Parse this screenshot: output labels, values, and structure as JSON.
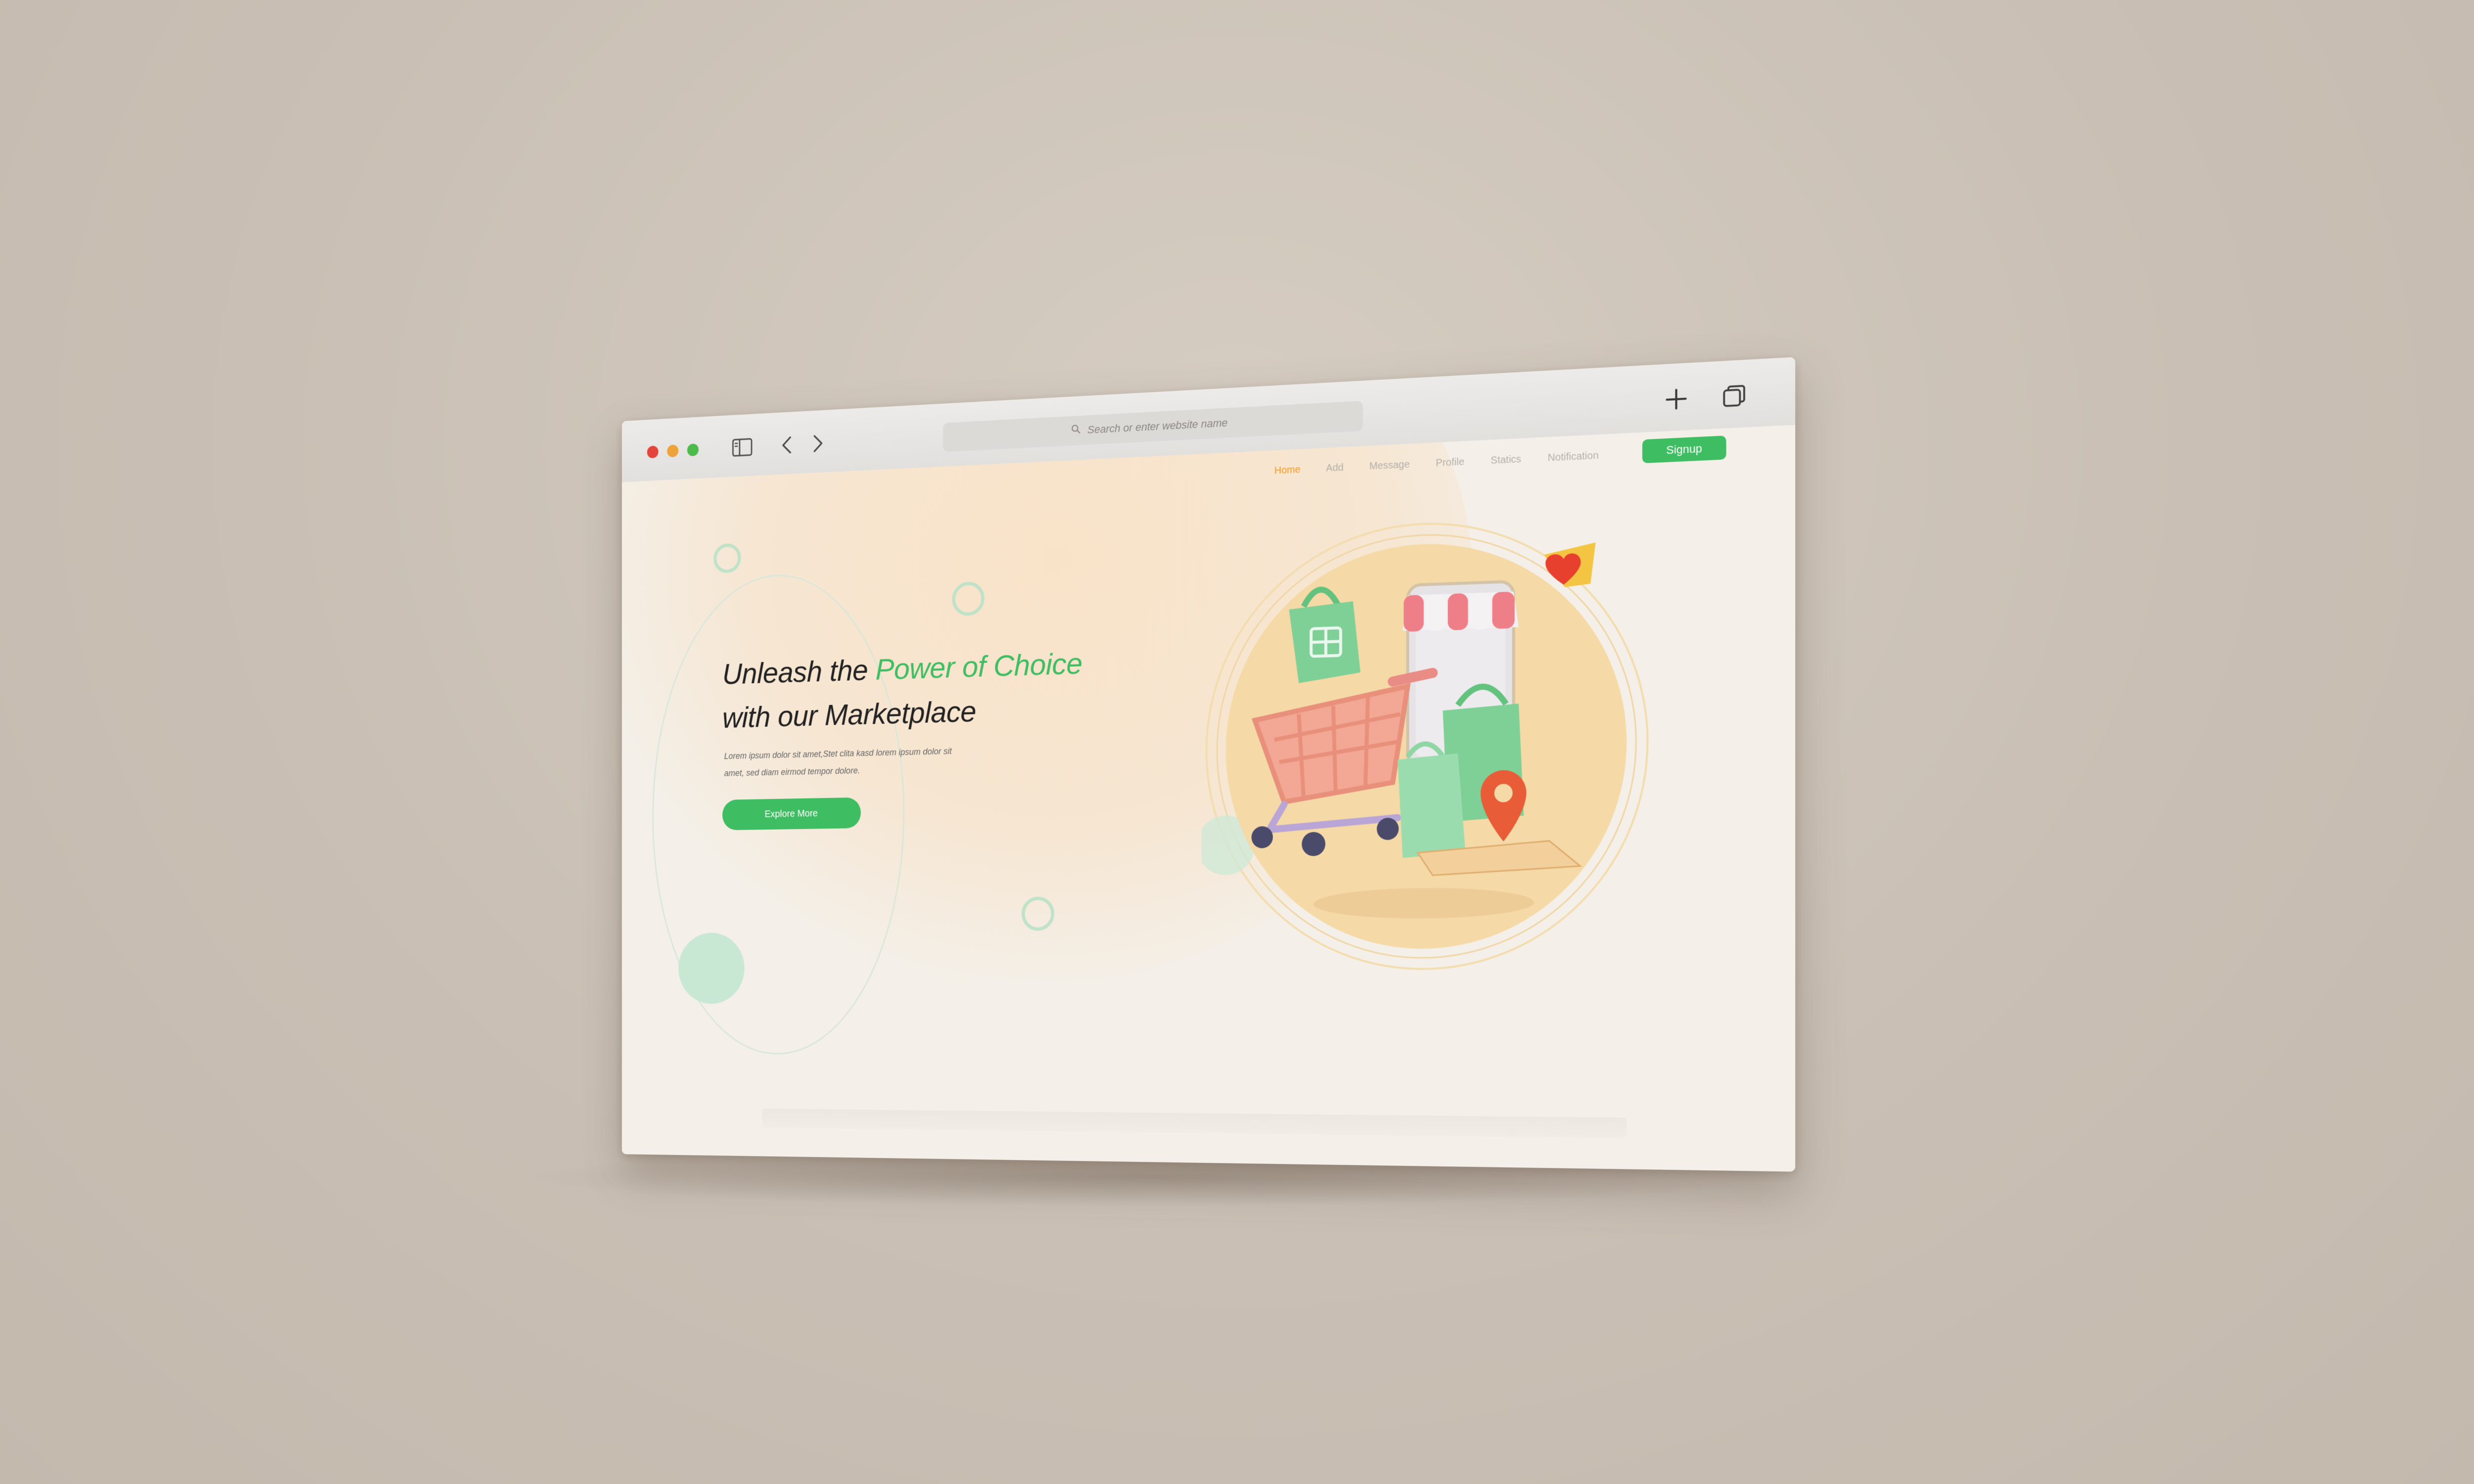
{
  "browser": {
    "search_placeholder": "Search or enter website name"
  },
  "nav": {
    "items": [
      {
        "label": "Home",
        "active": true
      },
      {
        "label": "Add",
        "active": false
      },
      {
        "label": "Message",
        "active": false
      },
      {
        "label": "Profile",
        "active": false
      },
      {
        "label": "Statics",
        "active": false
      },
      {
        "label": "Notification",
        "active": false
      }
    ],
    "signup_label": "Signup"
  },
  "hero": {
    "title_part1": "Unleash the ",
    "title_accent": "Power of Choice",
    "title_line2": "with our Marketplace",
    "description_line1": "Lorem ipsum dolor sit amet,Stet clita kasd lorem ipsum dolor sit",
    "description_line2": "amet, sed diam  eirmod tempor dolore.",
    "cta_label": "Explore More"
  },
  "colors": {
    "accent_green": "#3fbd62",
    "active_nav": "#f39a1e",
    "peach": "#f6d9a8",
    "background": "#c9bfb4"
  },
  "icons": [
    "sidebar-toggle-icon",
    "chevron-left-icon",
    "chevron-right-icon",
    "search-icon",
    "plus-icon",
    "tabs-icon",
    "heart-icon",
    "shopping-cart-icon",
    "shopping-bag-icon",
    "location-pin-icon",
    "storefront-awning-icon"
  ]
}
